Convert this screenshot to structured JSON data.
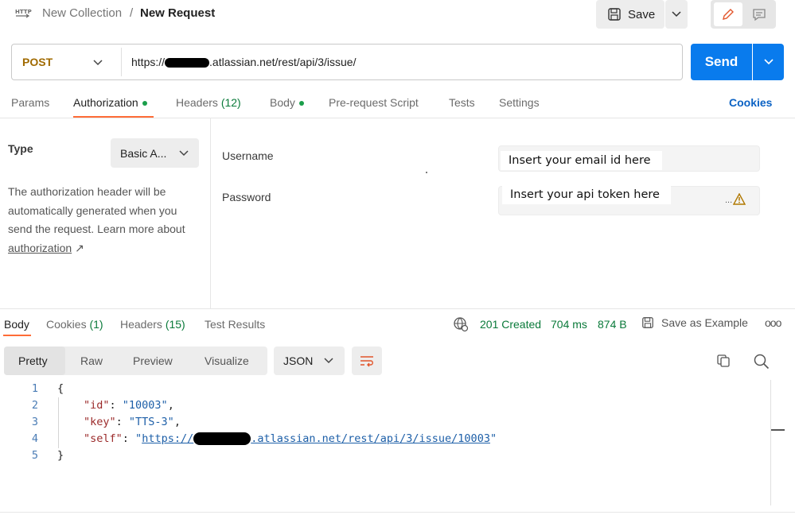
{
  "header": {
    "icon": "http-icon",
    "collection": "New Collection",
    "separator": "/",
    "request_name": "New Request",
    "save_label": "Save"
  },
  "request": {
    "method": "POST",
    "url_prefix": "https://",
    "url_suffix": ".atlassian.net/rest/api/3/issue/",
    "send_label": "Send"
  },
  "tabs": {
    "params": "Params",
    "authorization": "Authorization",
    "headers": "Headers",
    "headers_count": "(12)",
    "body": "Body",
    "prerequest": "Pre-request Script",
    "tests": "Tests",
    "settings": "Settings",
    "cookies": "Cookies"
  },
  "auth": {
    "type_label": "Type",
    "type_value": "Basic A...",
    "description": "The authorization header will be automatically generated when you send the request. Learn more about",
    "link": "authorization",
    "link_arrow": "↗",
    "username_label": "Username",
    "username_value": "Insert your email id here",
    "password_label": "Password",
    "password_value": "Insert your api token here",
    "password_suffix": "..."
  },
  "response": {
    "tabs": {
      "body": "Body",
      "cookies": "Cookies",
      "cookies_count": "(1)",
      "headers": "Headers",
      "headers_count": "(15)",
      "test_results": "Test Results"
    },
    "status": "201 Created",
    "time": "704 ms",
    "size": "874 B",
    "save_example": "Save as Example",
    "more": "ooo",
    "views": [
      "Pretty",
      "Raw",
      "Preview",
      "Visualize"
    ],
    "format": "JSON",
    "line_numbers": [
      "1",
      "2",
      "3",
      "4",
      "5"
    ],
    "json": {
      "open_brace": "{",
      "id_key": "\"id\"",
      "id_value": "\"10003\"",
      "key_key": "\"key\"",
      "key_value": "\"TTS-3\"",
      "self_key": "\"self\"",
      "self_value_prefix": "https://",
      "self_value_suffix": ".atlassian.net/rest/api/3/issue/10003",
      "close_brace": "}"
    }
  },
  "colors": {
    "send": "#097bed",
    "method": "#a06a00",
    "status_green": "#0a7a3a",
    "tab_underline": "#ff6c37",
    "cookies_link": "#0b62c4"
  }
}
